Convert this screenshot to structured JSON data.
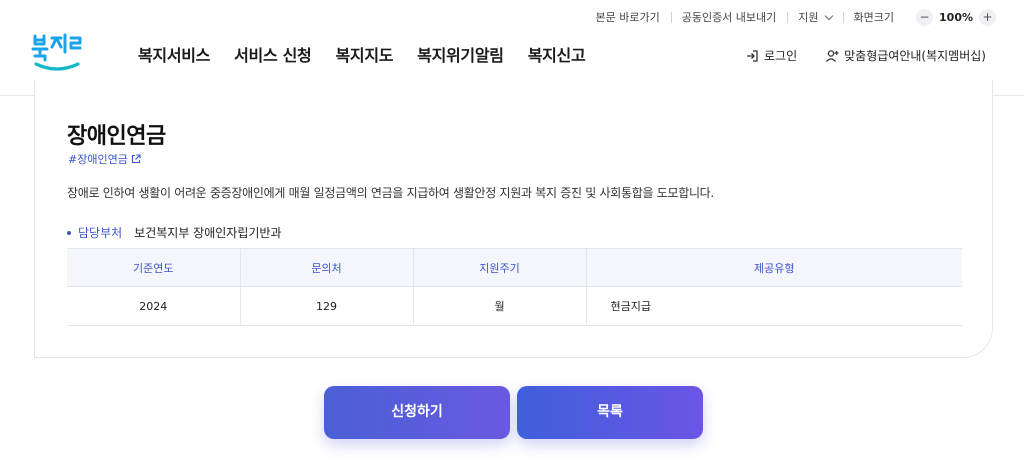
{
  "util": {
    "skip": "본문 바로가기",
    "cert": "공동인증서 내보내기",
    "support": "지원",
    "zoom_label": "화면크기",
    "zoom_minus": "−",
    "zoom_value": "100%",
    "zoom_plus": "+"
  },
  "logo": {
    "text": "복지로",
    "icon": "bokjiro-logo"
  },
  "gnb": [
    "복지서비스",
    "서비스 신청",
    "복지지도",
    "복지위기알림",
    "복지신고"
  ],
  "user": {
    "login": "로그인",
    "custom": "맞춤형급여안내(복지멤버십)"
  },
  "content": {
    "title": "장애인연금",
    "tag": "#장애인연금",
    "description": "장애로 인하여 생활이 어려운 중증장애인에게 매월 일정금액의 연금을 지급하여 생활안정 지원과 복지 증진 및 사회통합을 도모합니다.",
    "dept_label": "담당부처",
    "dept_value": "보건복지부 장애인자립기반과"
  },
  "table": {
    "headers": [
      "기준연도",
      "문의처",
      "지원주기",
      "제공유형"
    ],
    "row": [
      "2024",
      "129",
      "월",
      "현금지급"
    ]
  },
  "buttons": {
    "apply": "신청하기",
    "list": "목록"
  },
  "colors": {
    "accent": "#3d55c8",
    "button_start": "#4a5fd6",
    "button_end": "#6a5ae0",
    "logo_blue": "#1aa3e8"
  }
}
